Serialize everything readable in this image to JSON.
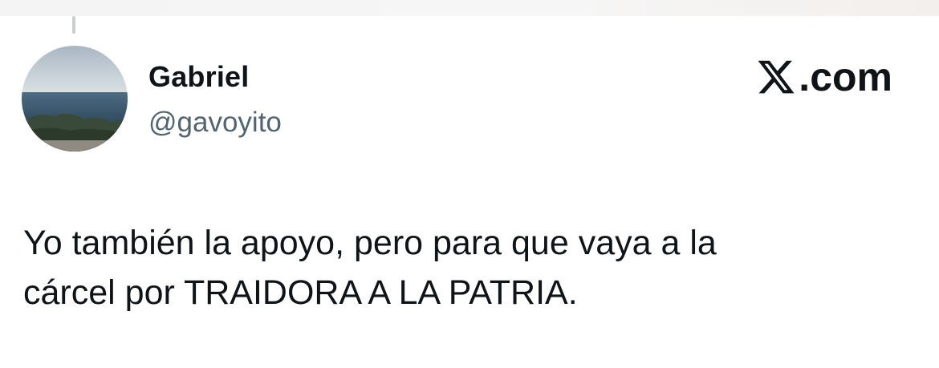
{
  "tweet": {
    "author": {
      "display_name": "Gabriel",
      "handle": "@gavoyito",
      "avatar": "coastal-landscape-avatar"
    },
    "brand": {
      "icon": "x-logo-icon",
      "text": ".com"
    },
    "text": "Yo también la apoyo, pero para que vaya a la\ncárcel por TRAIDORA A LA PATRIA."
  }
}
